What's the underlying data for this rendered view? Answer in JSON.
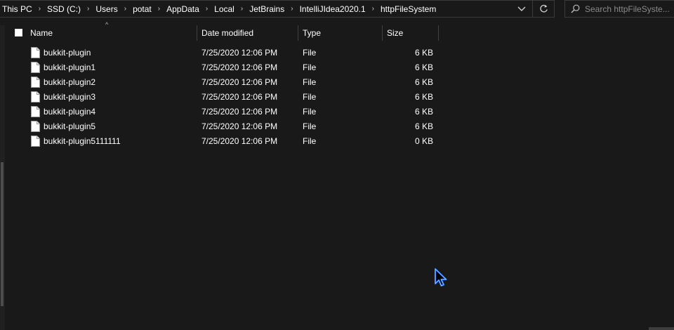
{
  "address_bar": {
    "breadcrumbs": [
      "This PC",
      "SSD (C:)",
      "Users",
      "potat",
      "AppData",
      "Local",
      "JetBrains",
      "IntelliJIdea2020.1",
      "httpFileSystem"
    ],
    "separator": "›",
    "history_icon": "chevron-down-icon",
    "refresh_icon": "refresh-icon"
  },
  "search": {
    "placeholder": "Search httpFileSyste..."
  },
  "columns": {
    "name": "Name",
    "date": "Date modified",
    "type": "Type",
    "size": "Size"
  },
  "files": [
    {
      "name": "bukkit-plugin",
      "date": "7/25/2020 12:06 PM",
      "type": "File",
      "size": "6 KB"
    },
    {
      "name": "bukkit-plugin1",
      "date": "7/25/2020 12:06 PM",
      "type": "File",
      "size": "6 KB"
    },
    {
      "name": "bukkit-plugin2",
      "date": "7/25/2020 12:06 PM",
      "type": "File",
      "size": "6 KB"
    },
    {
      "name": "bukkit-plugin3",
      "date": "7/25/2020 12:06 PM",
      "type": "File",
      "size": "6 KB"
    },
    {
      "name": "bukkit-plugin4",
      "date": "7/25/2020 12:06 PM",
      "type": "File",
      "size": "6 KB"
    },
    {
      "name": "bukkit-plugin5",
      "date": "7/25/2020 12:06 PM",
      "type": "File",
      "size": "6 KB"
    },
    {
      "name": "bukkit-plugin5111111",
      "date": "7/25/2020 12:06 PM",
      "type": "File",
      "size": "0 KB"
    }
  ],
  "colors": {
    "background": "#191919",
    "text": "#ffffff",
    "border": "#3a3a3a",
    "cursor_accent": "#1e6bff"
  }
}
